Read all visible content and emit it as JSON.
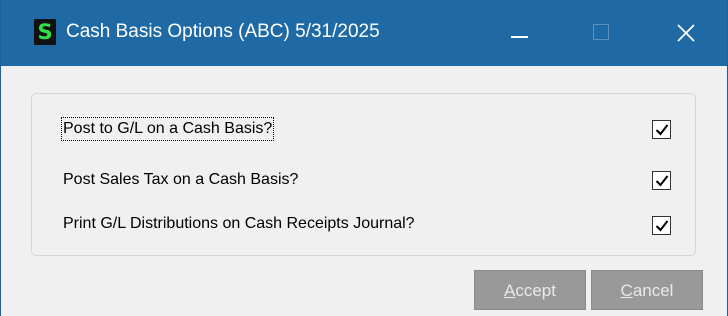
{
  "window": {
    "title": "Cash Basis Options (ABC) 5/31/2025",
    "app_icon_glyph": "S",
    "controls": [
      "minimize-icon",
      "maximize-icon",
      "close-icon"
    ]
  },
  "options": [
    {
      "label": "Post to G/L on a Cash Basis?",
      "checked": true
    },
    {
      "label": "Post Sales Tax on a Cash Basis?",
      "checked": true
    },
    {
      "label": "Print G/L Distributions on Cash Receipts Journal?",
      "checked": true
    }
  ],
  "buttons": {
    "accept": {
      "mnemonic": "A",
      "rest": "ccept",
      "label": "Accept"
    },
    "cancel": {
      "mnemonic": "C",
      "rest": "ancel",
      "label": "Cancel"
    }
  },
  "colors": {
    "titlebar": "#1f6aa5",
    "app_icon_bg": "#111111",
    "app_icon_fg": "#2ee04a",
    "button_bg": "#999999",
    "dialog_bg": "#f0f0f0"
  }
}
